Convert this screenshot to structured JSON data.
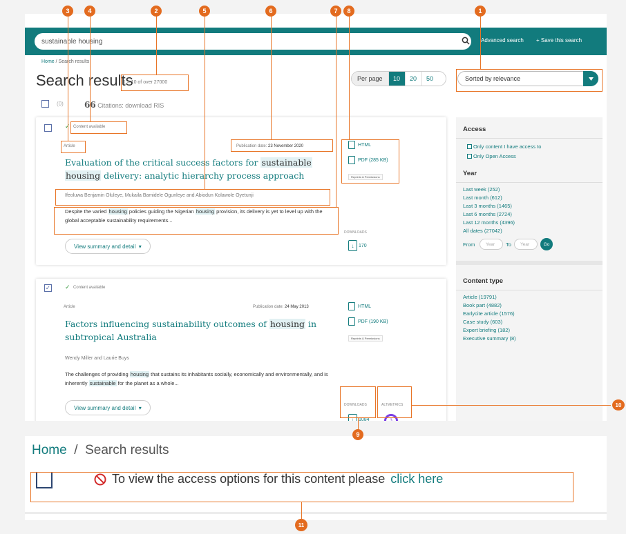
{
  "search": {
    "value": "sustainable housing",
    "advanced_label": "Advanced search",
    "save_label": "+ Save this search"
  },
  "breadcrumb": {
    "home": "Home",
    "separator": "/",
    "current": "Search results"
  },
  "results_header": {
    "title": "Search results",
    "count": "1 – 10 of over 27000",
    "per_page_label": "Per page",
    "per_page_options": [
      "10",
      "20",
      "50"
    ],
    "per_page_selected": "10",
    "sort_label": "Sorted by relevance"
  },
  "selection": {
    "count": "(0)",
    "cite_quote": "66",
    "cite_label": "Citations: download RIS"
  },
  "results": [
    {
      "content_status": "Content available",
      "type": "Article",
      "pub_date_label": "Publication date:",
      "pub_date": "23 November 2020",
      "title_parts": [
        "Evaluation of the critical success factors for ",
        "sustainable",
        " ",
        "housing",
        "",
        " delivery: analytic hierarchy process approach"
      ],
      "authors": "Ifeoluwa Benjamin Oluleye, Mukaila Bamidele Ogunleye and Abiodun Kolawole Oyetunji",
      "abstract_parts": [
        "Despite the varied ",
        "housing",
        " policies guiding the Nigerian ",
        "housing",
        " provision, its delivery is yet to level up with the global acceptable sustainability requirements..."
      ],
      "html_label": "HTML",
      "pdf_label": "PDF (285 KB)",
      "reprints_label": "Reprints & Permissions",
      "downloads_label": "DOWNLOADS",
      "downloads": "170",
      "view_label": "View summary and detail",
      "checked": false
    },
    {
      "content_status": "Content available",
      "type": "Article",
      "pub_date_label": "Publication date:",
      "pub_date": "24 May 2013",
      "title_parts": [
        "Factors influencing sustainability outcomes of ",
        "housing",
        " in subtropical Australia"
      ],
      "authors": "Wendy Miller and Laurie Buys",
      "abstract_parts": [
        "The challenges of providing ",
        "housing",
        " that sustains its inhabitants socially, economically and environmentally, and is inherently ",
        "sustainable",
        " for the planet as a whole..."
      ],
      "html_label": "HTML",
      "pdf_label": "PDF (190 KB)",
      "reprints_label": "Reprints & Permissions",
      "downloads_label": "DOWNLOADS",
      "downloads": "1084",
      "altmetrics_label": "ALTMETRICS",
      "altmetric_score": "3",
      "view_label": "View summary and detail",
      "checked": true
    }
  ],
  "sidebar": {
    "access_heading": "Access",
    "access_options": [
      "Only content I have access to",
      "Only Open Access"
    ],
    "year_heading": "Year",
    "year_options": [
      "Last week (252)",
      "Last month (612)",
      "Last 3 months (1465)",
      "Last 6 months (2724)",
      "Last 12 months (4396)",
      "All dates (27042)"
    ],
    "from_label": "From",
    "to_label": "To",
    "year_placeholder": "Year",
    "go_label": "Go",
    "content_type_heading": "Content type",
    "content_types": [
      "Article (19791)",
      "Book part (4882)",
      "Earlycite article (1576)",
      "Case study (603)",
      "Expert briefing (182)",
      "Executive summary (8)"
    ]
  },
  "access_notice": {
    "text": "To view the access options for this content please",
    "link": "click here"
  },
  "markers": [
    "1",
    "2",
    "3",
    "4",
    "5",
    "6",
    "7",
    "8",
    "9",
    "10",
    "11"
  ],
  "colors": {
    "accent": "#127b7d",
    "annotation": "#e87527",
    "marker": "#e36b1f",
    "available": "#3c9a42",
    "altmetric": "#7b3fe4"
  }
}
